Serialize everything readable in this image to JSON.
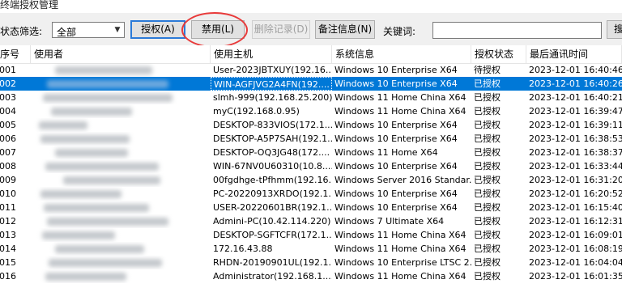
{
  "window": {
    "title": "终端授权管理"
  },
  "toolbar": {
    "filter_label": "状态筛选:",
    "filter_value": "全部",
    "authorize_label": "授权(A)",
    "disable_label": "禁用(L)",
    "delete_label": "删除记录(D)",
    "note_label": "备注信息(N)",
    "keyword_label": "关键词:",
    "keyword_value": "",
    "search_label": "搜"
  },
  "table": {
    "columns": [
      "序号",
      "使用者",
      "使用主机",
      "系统信息",
      "授权状态",
      "最后通讯时间"
    ],
    "rows": [
      {
        "no": "001",
        "user": "",
        "host": "User-2023JBTXUY(192.16...",
        "os": "Windows 10 Enterprise X64",
        "status": "待授权",
        "time": "2023-12-01 16:40:46"
      },
      {
        "no": "002",
        "user": "",
        "host": "WIN-AGFJVG2A4FN(192....",
        "os": "Windows 10 Enterprise X64",
        "status": "已授权",
        "time": "2023-12-01 16:40:26"
      },
      {
        "no": "003",
        "user": "",
        "host": "slmh-999(192.168.25.200)",
        "os": "Windows 11 Home China X64",
        "status": "已授权",
        "time": "2023-12-01 16:40:21"
      },
      {
        "no": "004",
        "user": "",
        "host": "myC(192.168.0.95)",
        "os": "Windows 11 Home China X64",
        "status": "已授权",
        "time": "2023-12-01 16:39:47"
      },
      {
        "no": "005",
        "user": "",
        "host": "DESKTOP-833VIOS(172.1...",
        "os": "Windows 10 Enterprise X64",
        "status": "已授权",
        "time": "2023-12-01 16:39:11"
      },
      {
        "no": "006",
        "user": "",
        "host": "DESKTOP-A5P7SAH(192.1...",
        "os": "Windows 10 Enterprise X64",
        "status": "已授权",
        "time": "2023-12-01 16:38:53"
      },
      {
        "no": "007",
        "user": "",
        "host": "DESKTOP-OQ3JG48(172....",
        "os": "Windows 11 Home X64",
        "status": "已授权",
        "time": "2023-12-01 16:38:37"
      },
      {
        "no": "008",
        "user": "",
        "host": "WIN-67NV0U60310(10.8....",
        "os": "Windows 10 Enterprise X64",
        "status": "已授权",
        "time": "2023-12-01 16:33:44"
      },
      {
        "no": "009",
        "user": "",
        "host": "00fgdhge-tPfhmm(192.16...",
        "os": "Windows Server 2016 Standar...",
        "status": "已授权",
        "time": "2023-12-01 16:31:20"
      },
      {
        "no": "010",
        "user": "",
        "host": "PC-20220913XRDO(192.1...",
        "os": "Windows 10 Enterprise X64",
        "status": "已授权",
        "time": "2023-12-01 16:20:52"
      },
      {
        "no": "011",
        "user": "",
        "host": "USER-20220601BR(192.1...",
        "os": "Windows 10 Enterprise X64",
        "status": "已授权",
        "time": "2023-12-01 16:15:40"
      },
      {
        "no": "012",
        "user": "",
        "host": "Admini-PC(10.42.114.220)",
        "os": "Windows 7 Ultimate X64",
        "status": "已授权",
        "time": "2023-12-01 16:12:31"
      },
      {
        "no": "013",
        "user": "",
        "host": "DESKTOP-SGFTCFR(172.1...",
        "os": "Windows 11 Home China X64",
        "status": "已授权",
        "time": "2023-12-01 16:09:01"
      },
      {
        "no": "014",
        "user": "",
        "host": "172.16.43.88",
        "os": "Windows 11 Home China X64",
        "status": "已授权",
        "time": "2023-12-01 16:08:19"
      },
      {
        "no": "015",
        "user": "",
        "host": "RHDN-20190901UL(192.1...",
        "os": "Windows 10 Enterprise LTSC 2...",
        "status": "已授权",
        "time": "2023-12-01 16:04:04"
      },
      {
        "no": "016",
        "user": "",
        "host": "Administrator(192.168.1....",
        "os": "Windows 11 Home China X64",
        "status": "已授权",
        "time": "2023-12-01 16:01:35"
      }
    ],
    "selected_index": 1
  },
  "colors": {
    "selection": "#0078d7",
    "annotation": "#e83a3a"
  }
}
